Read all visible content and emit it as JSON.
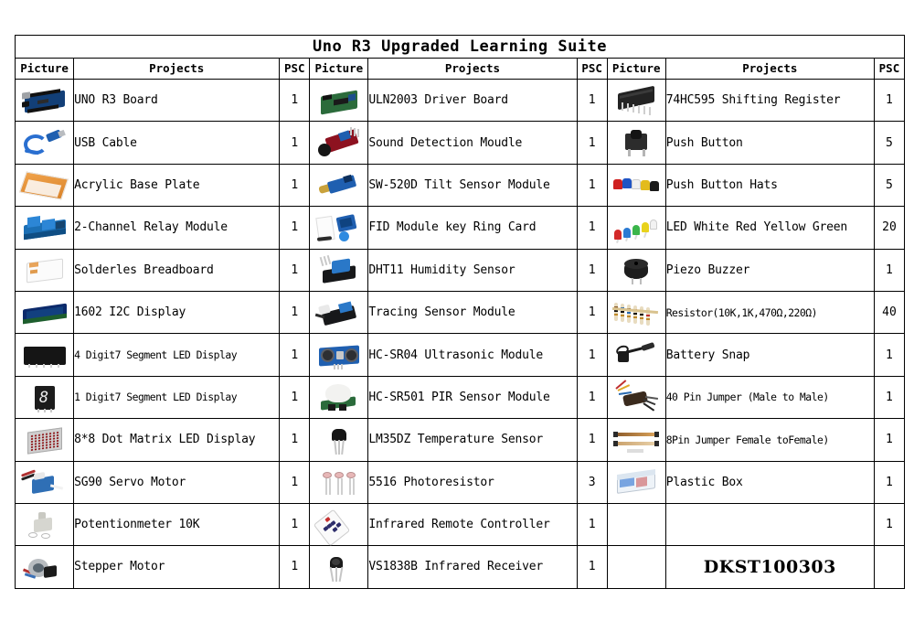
{
  "title": "Uno R3 Upgraded Learning Suite",
  "headers": {
    "picture": "Picture",
    "projects": "Projects",
    "psc": "PSC"
  },
  "product_code": "DKST100303",
  "columns": [
    {
      "id": "column-1",
      "rows": [
        {
          "icon": "uno-r3-board-icon",
          "project": "UNO R3 Board",
          "psc": "1"
        },
        {
          "icon": "usb-cable-icon",
          "project": "USB Cable",
          "psc": "1"
        },
        {
          "icon": "acrylic-base-plate-icon",
          "project": "Acrylic Base Plate",
          "psc": "1"
        },
        {
          "icon": "relay-module-icon",
          "project": "2-Channel Relay Module",
          "psc": "1"
        },
        {
          "icon": "breadboard-icon",
          "project": "Solderles Breadboard",
          "psc": "1"
        },
        {
          "icon": "lcd1602-icon",
          "project": "1602 I2C Display",
          "psc": "1"
        },
        {
          "icon": "four-digit-display-icon",
          "project": "4 Digit7 Segment LED Display",
          "psc": "1"
        },
        {
          "icon": "one-digit-display-icon",
          "project": "1 Digit7 Segment LED Display",
          "psc": "1"
        },
        {
          "icon": "dot-matrix-icon",
          "project": "8*8 Dot Matrix LED Display",
          "psc": "1"
        },
        {
          "icon": "servo-motor-icon",
          "project": "SG90 Servo Motor",
          "psc": "1"
        },
        {
          "icon": "potentiometer-icon",
          "project": "Potentionmeter 10K",
          "psc": "1"
        },
        {
          "icon": "stepper-motor-icon",
          "project": "Stepper Motor",
          "psc": "1"
        }
      ]
    },
    {
      "id": "column-2",
      "rows": [
        {
          "icon": "uln2003-driver-icon",
          "project": "ULN2003 Driver Board",
          "psc": "1"
        },
        {
          "icon": "sound-detection-icon",
          "project": "Sound Detection Moudle",
          "psc": "1"
        },
        {
          "icon": "tilt-sensor-icon",
          "project": "SW-520D Tilt Sensor Module",
          "psc": "1"
        },
        {
          "icon": "rfid-module-icon",
          "project": "FID Module key Ring Card",
          "psc": "1"
        },
        {
          "icon": "dht11-sensor-icon",
          "project": "DHT11 Humidity Sensor",
          "psc": "1"
        },
        {
          "icon": "tracing-sensor-icon",
          "project": "Tracing Sensor Module",
          "psc": "1"
        },
        {
          "icon": "ultrasonic-sensor-icon",
          "project": "HC-SR04 Ultrasonic Module",
          "psc": "1"
        },
        {
          "icon": "pir-sensor-icon",
          "project": "HC-SR501 PIR Sensor Module",
          "psc": "1"
        },
        {
          "icon": "lm35dz-sensor-icon",
          "project": "LM35DZ Temperature Sensor",
          "psc": "1"
        },
        {
          "icon": "photoresistor-icon",
          "project": "5516 Photoresistor",
          "psc": "3"
        },
        {
          "icon": "ir-remote-icon",
          "project": "Infrared Remote Controller",
          "psc": "1"
        },
        {
          "icon": "ir-receiver-icon",
          "project": "VS1838B Infrared Receiver",
          "psc": "1"
        }
      ]
    },
    {
      "id": "column-3",
      "rows": [
        {
          "icon": "shift-register-icon",
          "project": "74HC595 Shifting Register",
          "psc": "1"
        },
        {
          "icon": "push-button-icon",
          "project": "Push Button",
          "psc": "5"
        },
        {
          "icon": "button-hats-icon",
          "project": "Push Button Hats",
          "psc": "5"
        },
        {
          "icon": "led-assorted-icon",
          "project": "LED White Red Yellow Green",
          "psc": "20"
        },
        {
          "icon": "piezo-buzzer-icon",
          "project": "Piezo Buzzer",
          "psc": "1"
        },
        {
          "icon": "resistor-pack-icon",
          "project": "Resistor(10K,1K,470Ω,220Ω)",
          "psc": "40"
        },
        {
          "icon": "battery-snap-icon",
          "project": "Battery Snap",
          "psc": "1"
        },
        {
          "icon": "jumper-male-icon",
          "project": "40 Pin Jumper (Male to Male)",
          "psc": "1"
        },
        {
          "icon": "jumper-female-icon",
          "project": "8Pin Jumper Female toFemale)",
          "psc": "1"
        },
        {
          "icon": "plastic-box-icon",
          "project": "Plastic Box",
          "psc": "1"
        },
        {
          "icon": "",
          "project": "",
          "psc": "1"
        },
        {
          "icon": "",
          "project": "",
          "psc": ""
        }
      ]
    }
  ]
}
